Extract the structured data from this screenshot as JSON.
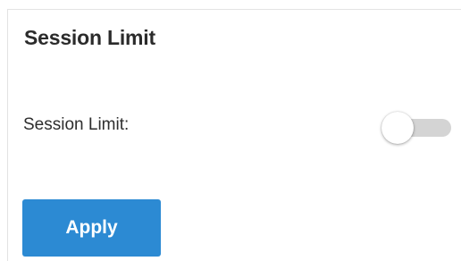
{
  "section": {
    "title": "Session Limit"
  },
  "fields": {
    "session_limit": {
      "label": "Session Limit:",
      "enabled": false
    }
  },
  "actions": {
    "apply_label": "Apply"
  },
  "colors": {
    "accent": "#2c8ad3",
    "toggle_off_track": "#d4d4d4",
    "text": "#2e2e2e"
  }
}
